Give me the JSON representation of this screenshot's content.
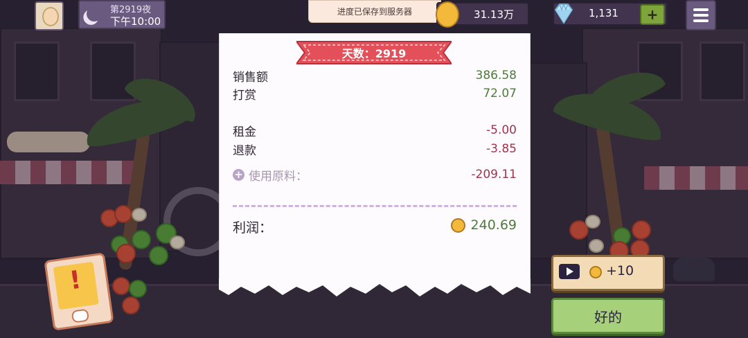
{
  "header": {
    "night_label": "第2919夜",
    "time_label": "下午10:00",
    "toast": "进度已保存到服务器",
    "coins": "31.13万",
    "gems": "1,131",
    "add_gems_label": "+"
  },
  "receipt": {
    "day_banner": "天数：2919",
    "sales_label": "销售额",
    "sales_value": "386.58",
    "tips_label": "打赏",
    "tips_value": "72.07",
    "rent_label": "租金",
    "rent_value": "-5.00",
    "refund_label": "退款",
    "refund_value": "-3.85",
    "ingredients_label": "使用原料：",
    "ingredients_value": "-209.11",
    "profit_label": "利润：",
    "profit_value": "240.69"
  },
  "actions": {
    "ad_reward": "+10",
    "ok": "好的"
  },
  "icons": {
    "moon": "moon-icon",
    "coin": "coin-icon",
    "gem": "diamond-icon",
    "menu": "hamburger-menu-icon",
    "play": "play-video-icon",
    "alert": "exclamation-icon",
    "expand": "plus-circle-icon"
  },
  "colors": {
    "positive": "#4e7a3e",
    "negative": "#a0344a",
    "banner": "#e4505a",
    "ok_button": "#a6d07a",
    "ad_button": "#f3dcb5"
  }
}
